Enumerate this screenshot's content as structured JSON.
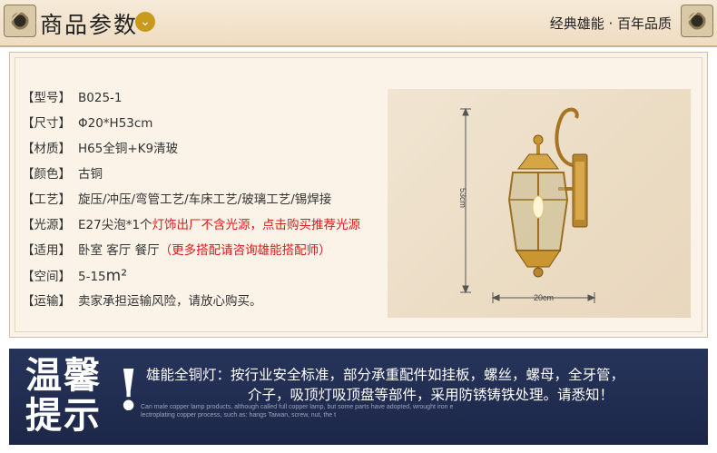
{
  "header": {
    "title": "商品参数",
    "slogan": "经典雄能 · 百年品质"
  },
  "specs": [
    {
      "label": "【型号】",
      "value": "B025-1",
      "note": ""
    },
    {
      "label": "【尺寸】",
      "value": "Φ20*H53cm",
      "note": ""
    },
    {
      "label": "【材质】",
      "value": "H65全铜+K9清玻",
      "note": ""
    },
    {
      "label": "【颜色】",
      "value": "古铜",
      "note": ""
    },
    {
      "label": "【工艺】",
      "value": "旋压/冲压/弯管工艺/车床工艺/玻璃工艺/锡焊接",
      "note": ""
    },
    {
      "label": "【光源】",
      "value": "E27尖泡*1个",
      "note": "灯饰出厂不含光源，点击购买推荐光源"
    },
    {
      "label": "【适用】",
      "value": "卧室  客厅  餐厅",
      "note": "（更多搭配请咨询雄能搭配师）"
    },
    {
      "label": "【空间】",
      "value": "5-15",
      "unit": "m²",
      "note": ""
    },
    {
      "label": "【运输】",
      "value": "卖家承担运输风险，请放心购买。",
      "note": ""
    }
  ],
  "product": {
    "height_label": "53cm",
    "width_label": "20cm"
  },
  "tips": {
    "mark": "温馨提示",
    "mark_line1": "温馨",
    "mark_line2": "提示",
    "bang": "!",
    "line1": "雄能全铜灯：按行业安全标准，部分承重配件如挂板，螺丝，螺母，全牙管，",
    "line2": "介子，吸顶灯吸顶盘等部件，采用防锈铸铁处理。请悉知！",
    "en_line1": "Can male copper lamp products, although called full copper lamp, but some parts have adopted, wrought iron e",
    "en_line2": "lectroplating copper process, such as: hangs Taiwan, screw, nut, the t"
  },
  "colors": {
    "accent_red": "#e01818",
    "banner_navy": "#1c2748",
    "gold": "#c79a1e"
  }
}
